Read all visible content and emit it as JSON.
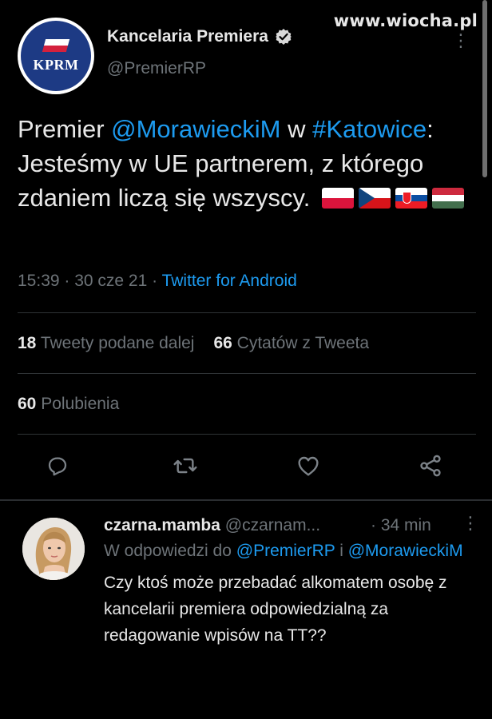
{
  "watermark": "www.wiocha.pl",
  "tweet": {
    "author_name": "Kancelaria Premiera",
    "author_handle": "@PremierRP",
    "avatar_text": "KPRM",
    "text": {
      "part1": "Premier ",
      "mention": "@MorawieckiM",
      "part2": " w ",
      "hashtag": "#Katowice",
      "part3": ": Jesteśmy w UE partnerem, z którego zdaniem liczą się wszyscy."
    },
    "flags": [
      "flag-pl-icon",
      "flag-cz-icon",
      "flag-sk-icon",
      "flag-hu-icon"
    ],
    "time": "15:39 · 30 cze 21 · ",
    "source": "Twitter for Android",
    "retweets_count": "18",
    "retweets_label": "Tweety podane dalej",
    "quotes_count": "66",
    "quotes_label": "Cytatów z Tweeta",
    "likes_count": "60",
    "likes_label": "Polubienia",
    "actions": [
      "reply-icon",
      "retweet-icon",
      "like-icon",
      "share-icon"
    ]
  },
  "reply": {
    "author_name": "czarna.mamba",
    "author_handle": "@czarnam...",
    "time": "· 34 min",
    "replying_to_prefix": "W odpowiedzi do ",
    "replying_to_1": "@PremierRP",
    "replying_to_and": " i ",
    "replying_to_2": "@MorawieckiM",
    "text": "Czy ktoś może przebadać alkomatem osobę z kancelarii premiera odpowiedzialną za redagowanie wpisów na TT??"
  },
  "colors": {
    "background": "#000000",
    "link": "#1d9bf0",
    "secondary_text": "#6e7479",
    "primary_text": "#e8e8e8",
    "divider": "#2f3336"
  }
}
